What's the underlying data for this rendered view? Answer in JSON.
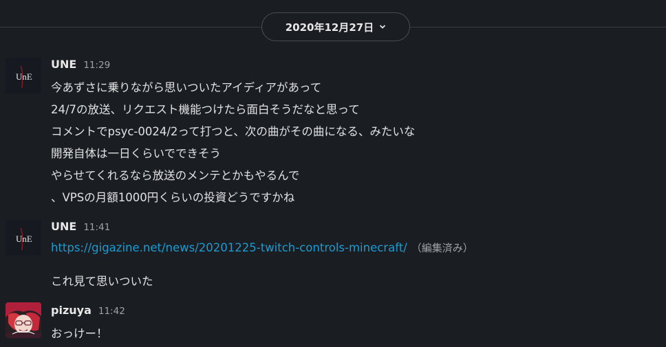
{
  "date_divider": {
    "label": "2020年12月27日",
    "icon": "chevron-down-icon"
  },
  "messages": [
    {
      "user": "UNE",
      "time": "11:29",
      "lines": [
        "今あずさに乗りながら思いついたアイディアがあって",
        "24/7の放送、リクエスト機能つけたら面白そうだなと思って",
        "コメントでpsyc-0024/2って打つと、次の曲がその曲になる、みたいな",
        "開発自体は一日くらいでできそう",
        "やらせてくれるなら放送のメンテとかもやるんで",
        "、VPSの月額1000円くらいの投資どうですかね"
      ]
    },
    {
      "user": "UNE",
      "time": "11:41",
      "link": "https://gigazine.net/news/20201225-twitch-controls-minecraft/",
      "edited": "（編集済み）",
      "followup": "これ見て思いついた"
    },
    {
      "user": "pizuya",
      "time": "11:42",
      "lines": [
        "おっけー！"
      ]
    }
  ],
  "colors": {
    "background": "#1a1d21",
    "link": "#1d9bd1",
    "text": "#e1e2e3",
    "muted": "#a0a2a5"
  }
}
